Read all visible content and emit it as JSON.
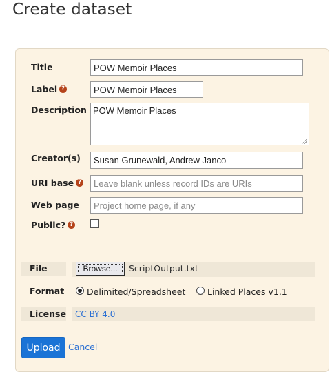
{
  "page": {
    "heading": "Create dataset"
  },
  "form": {
    "title": {
      "label": "Title",
      "value": "POW Memoir Places"
    },
    "label": {
      "label": "Label",
      "value": "POW Memoir Places"
    },
    "description": {
      "label": "Description",
      "value": "POW Memoir Places"
    },
    "creators": {
      "label": "Creator(s)",
      "value": "Susan Grunewald, Andrew Janco"
    },
    "uri_base": {
      "label": "URI base",
      "value": "",
      "placeholder": "Leave blank unless record IDs are URIs"
    },
    "web_page": {
      "label": "Web page",
      "value": "",
      "placeholder": "Project home page, if any"
    },
    "public": {
      "label": "Public?",
      "checked": false
    },
    "help_glyph": "?"
  },
  "file": {
    "label": "File",
    "browse_label": "Browse...",
    "filename": "ScriptOutput.txt"
  },
  "format": {
    "label": "Format",
    "options": [
      {
        "label": "Delimited/Spreadsheet",
        "selected": true
      },
      {
        "label": "Linked Places v1.1",
        "selected": false
      }
    ]
  },
  "license": {
    "label": "License",
    "value": "CC BY 4.0"
  },
  "actions": {
    "upload_label": "Upload",
    "cancel_label": "Cancel"
  },
  "colors": {
    "accent": "#1a73d6",
    "link": "#2a6fd3",
    "panel": "#fcf3e3",
    "help_icon": "#b5431a"
  }
}
